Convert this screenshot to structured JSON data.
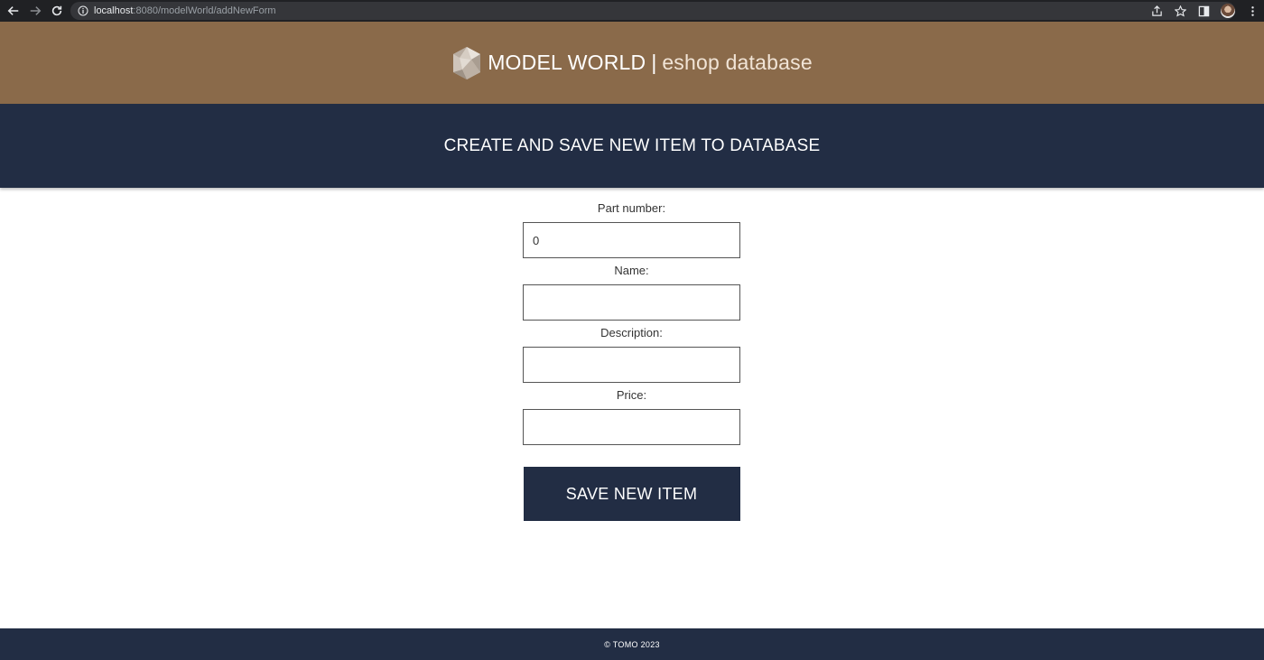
{
  "browser": {
    "url_host": "localhost",
    "url_rest": ":8080/modelWorld/addNewForm",
    "icons": [
      "back-arrow-icon",
      "forward-arrow-icon",
      "reload-icon",
      "info-icon",
      "share-icon",
      "star-icon",
      "sidebar-icon",
      "profile-avatar",
      "menu-dots-icon"
    ]
  },
  "header": {
    "brand_name": "MODEL WORLD",
    "separator": "|",
    "brand_sub": "eshop database",
    "logo_icon": "polyhedron-logo"
  },
  "title_bar": {
    "title": "CREATE AND SAVE NEW ITEM TO DATABASE"
  },
  "form": {
    "fields": [
      {
        "label": "Part number:",
        "value": "0"
      },
      {
        "label": "Name:",
        "value": ""
      },
      {
        "label": "Description:",
        "value": ""
      },
      {
        "label": "Price:",
        "value": ""
      }
    ],
    "submit_label": "SAVE NEW ITEM"
  },
  "footer": {
    "text": "© TOMO 2023"
  },
  "colors": {
    "brand_brown": "#8a6a4a",
    "navy": "#222d44",
    "chrome_dark": "#202124"
  }
}
